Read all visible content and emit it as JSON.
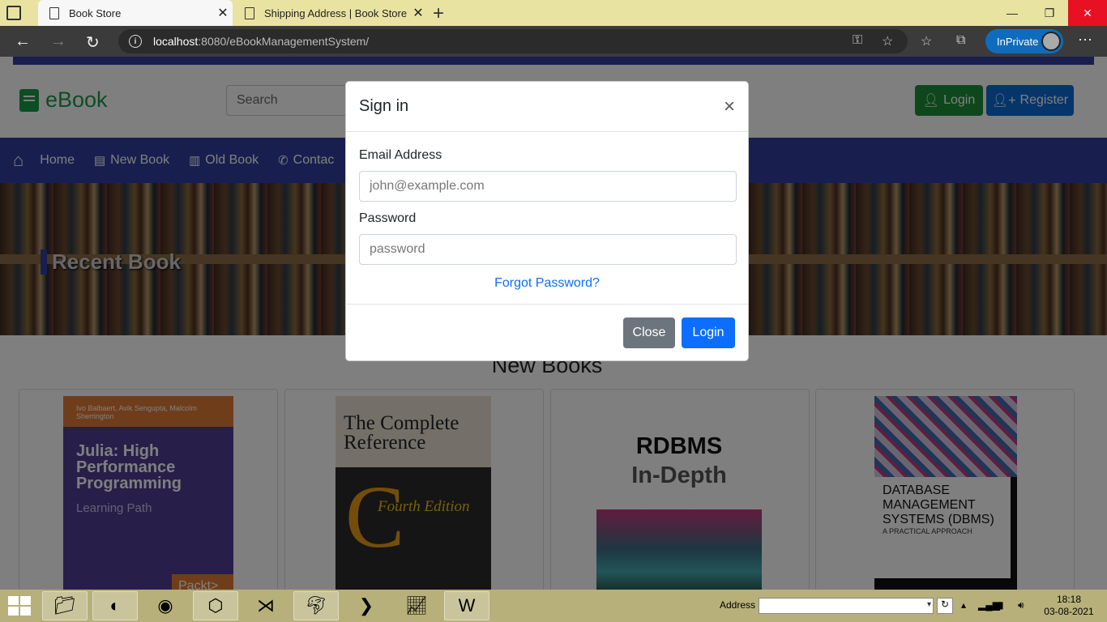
{
  "browser": {
    "tabs": [
      {
        "title": "Book Store",
        "active": true
      },
      {
        "title": "Shipping Address | Book Store",
        "active": false
      }
    ],
    "url_host": "localhost",
    "url_rest": ":8080/eBookManagementSystem/",
    "inprivate_label": "InPrivate"
  },
  "site": {
    "logo_text": "eBook",
    "search_placeholder": "Search",
    "login_button": "Login",
    "register_button": "Register",
    "nav": [
      {
        "label": "Home",
        "icon": "home-icon"
      },
      {
        "label": "New Book",
        "icon": "book-icon"
      },
      {
        "label": "Old Book",
        "icon": "open-book-icon"
      },
      {
        "label": "Contac",
        "icon": "phone-icon"
      }
    ],
    "banner_title": "Recent Book",
    "section_title": "New Books",
    "covers": {
      "julia_authors": "Ivo Balbaert, Avik Sengupta, Malcolm Sherrington",
      "julia_title": "Julia: High Performance Programming",
      "julia_subtitle": "Learning Path",
      "julia_publisher": "Packt>",
      "cref_title": "The Complete Reference",
      "cref_letter": "C",
      "cref_edition": "Fourth Edition",
      "rdbms_title_1": "RDBMS",
      "rdbms_title_2": "In-Depth",
      "dbms_title": "DATABASE MANAGEMENT SYSTEMS (DBMS)",
      "dbms_subtitle": "A PRACTICAL APPROACH"
    }
  },
  "modal": {
    "title": "Sign in",
    "email_label": "Email Address",
    "email_placeholder": "john@example.com",
    "password_label": "Password",
    "password_placeholder": "password",
    "forgot_link": "Forgot Password?",
    "close_button": "Close",
    "login_button": "Login"
  },
  "taskbar": {
    "address_label": "Address",
    "time": "18:18",
    "date": "03-08-2021"
  }
}
